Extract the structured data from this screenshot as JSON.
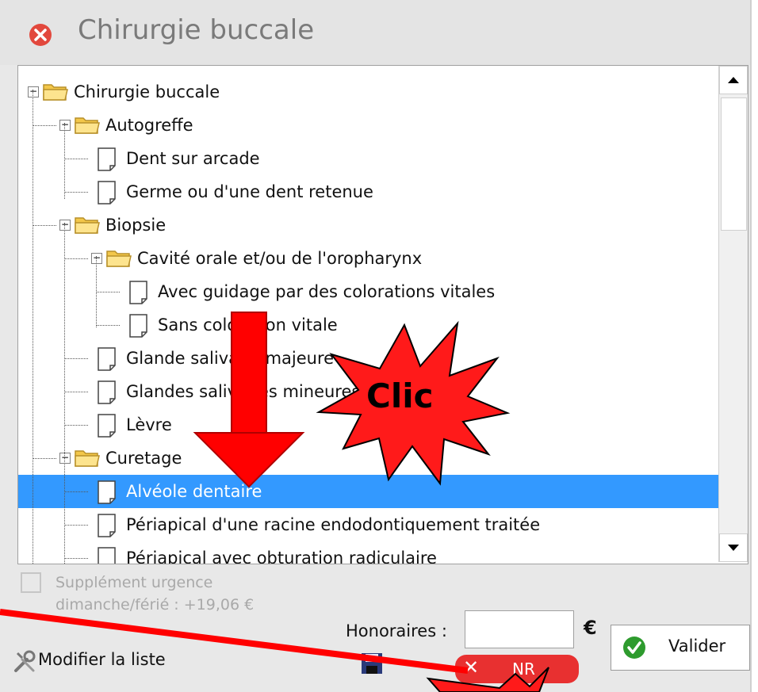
{
  "window": {
    "title": "Chirurgie buccale"
  },
  "tree": {
    "nodes": [
      {
        "label": "Chirurgie buccale",
        "type": "folder"
      },
      {
        "label": "Autogreffe",
        "type": "folder"
      },
      {
        "label": "Dent sur arcade",
        "type": "doc"
      },
      {
        "label": "Germe ou d'une dent retenue",
        "type": "doc"
      },
      {
        "label": "Biopsie",
        "type": "folder"
      },
      {
        "label": "Cavité orale et/ou de l'oropharynx",
        "type": "folder"
      },
      {
        "label": "Avec guidage par des colorations vitales",
        "type": "doc"
      },
      {
        "label": "Sans coloration vitale",
        "type": "doc"
      },
      {
        "label": "Glande salivaire majeure",
        "type": "doc"
      },
      {
        "label": "Glandes salivaires mineures",
        "type": "doc"
      },
      {
        "label": "Lèvre",
        "type": "doc"
      },
      {
        "label": "Curetage",
        "type": "folder"
      },
      {
        "label": "Alvéole dentaire",
        "type": "doc",
        "selected": true
      },
      {
        "label": "Périapical d'une racine endodontiquement traitée",
        "type": "doc"
      },
      {
        "label": "Périapical avec obturation radiculaire",
        "type": "doc"
      }
    ]
  },
  "footer": {
    "supplement_line1": "Supplément urgence",
    "supplement_line2": "dimanche/férié : +19,06 €",
    "honoraires_label": "Honoraires :",
    "fee_value": "",
    "currency": "€",
    "valider_label": "Valider",
    "modifier_label": "Modifier la liste",
    "nr_label": "NR"
  },
  "annotation": {
    "clic_label": "Clic"
  },
  "colors": {
    "selection": "#3399ff",
    "annotation_red": "#ff0000",
    "nr_button": "#e83030",
    "valider_check": "#2e9b2e"
  }
}
